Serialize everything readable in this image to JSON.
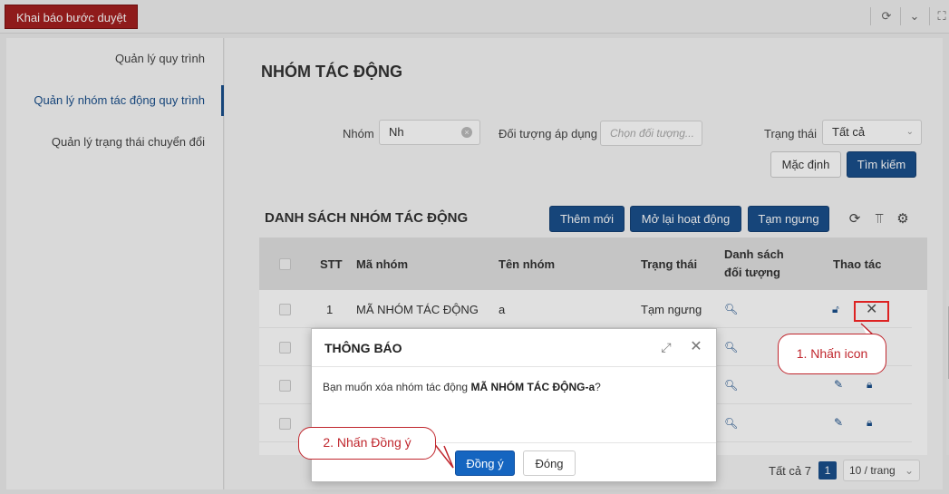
{
  "topbar": {
    "tab_label": "Khai báo bước duyệt"
  },
  "sidebar": {
    "items": [
      {
        "label": "Quản lý quy trình"
      },
      {
        "label": "Quản lý nhóm tác động quy trình"
      },
      {
        "label": "Quản lý trạng thái chuyển đổi"
      }
    ]
  },
  "main": {
    "title": "NHÓM TÁC ĐỘNG",
    "filters": {
      "group_label": "Nhóm",
      "group_value": "Nh",
      "target_label": "Đối tượng áp dụng",
      "target_placeholder": "Chọn đối tượng...",
      "status_label": "Trạng thái",
      "status_value": "Tất cả"
    },
    "buttons": {
      "default": "Mặc định",
      "search": "Tìm kiếm"
    },
    "list": {
      "title": "DANH SÁCH NHÓM TÁC ĐỘNG",
      "add": "Thêm mới",
      "reopen": "Mở lại hoạt động",
      "suspend": "Tạm ngưng"
    },
    "table": {
      "headers": {
        "stt": "STT",
        "code": "Mã nhóm",
        "name": "Tên nhóm",
        "status": "Trạng thái",
        "targets_line1": "Danh sách",
        "targets_line2": "đối tượng",
        "actions": "Thao tác"
      },
      "rows": [
        {
          "stt": "1",
          "code": "MÃ NHÓM TÁC ĐỘNG",
          "name": "a",
          "status": "Tạm ngưng"
        }
      ]
    },
    "pager": {
      "total": "Tất cả 7",
      "page": "1",
      "page_size": "10 / trang"
    }
  },
  "dialog": {
    "title": "THÔNG BÁO",
    "message_prefix": "Bạn muốn xóa nhóm tác động ",
    "message_bold": "MÃ NHÓM TÁC ĐỘNG-a",
    "message_suffix": "?",
    "confirm": "Đồng ý",
    "close": "Đóng"
  },
  "callouts": {
    "step1": "1. Nhấn icon",
    "step2": "2. Nhấn Đồng ý"
  },
  "colors": {
    "brand": "#1a4f8b",
    "tab": "#a31f1f",
    "callout": "#c0262d"
  }
}
